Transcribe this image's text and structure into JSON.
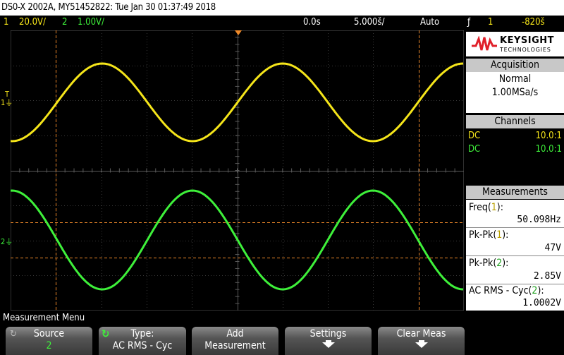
{
  "title_bar": "DS0-X 2002A, MY51452822: Tue Jan 30 01:37:49 2018",
  "status": {
    "ch1_num": "1",
    "ch1_scale": "20.0V/",
    "ch2_num": "2",
    "ch2_scale": "1.00V/",
    "time_offset": "0.0s",
    "timebase": "5.000š/",
    "trigger_mode": "Auto",
    "trigger_icon": "ƒ",
    "trigger_source": "1",
    "trigger_level": "-820š"
  },
  "markers": {
    "trigger_level": "T",
    "ch1": "1",
    "ch2": "2"
  },
  "logo": {
    "line1": "KEYSIGHT",
    "line2": "TECHNOLOGIES"
  },
  "acquisition": {
    "header": "Acquisition",
    "mode": "Normal",
    "rate": "1.00MSa/s"
  },
  "channels": {
    "header": "Channels",
    "rows": [
      {
        "coupling": "DC",
        "probe": "10.0:1"
      },
      {
        "coupling": "DC",
        "probe": "10.0:1"
      }
    ]
  },
  "measurements": {
    "header": "Measurements",
    "items": [
      {
        "label": "Freq(",
        "src": "1",
        "close": "):",
        "value": "50.098Hz"
      },
      {
        "label": "Pk-Pk(",
        "src": "1",
        "close": "):",
        "value": "47V"
      },
      {
        "label": "Pk-Pk(",
        "src": "2",
        "close": "):",
        "value": "2.85V"
      },
      {
        "label": "AC RMS - Cyc(",
        "src": "2",
        "close": "):",
        "value": "1.0002V"
      }
    ]
  },
  "menu_title": "Measurement Menu",
  "softkeys": {
    "source_top": "Source",
    "source_val": "2",
    "type_top": "Type:",
    "type_val": "AC RMS - Cyc",
    "add_top": "Add",
    "add_bottom": "Measurement",
    "settings_top": "Settings",
    "clear_top": "Clear Meas"
  },
  "colors": {
    "ch1": "#f5e51a",
    "ch2": "#3ef03a",
    "cursor": "#f08a2a"
  }
}
